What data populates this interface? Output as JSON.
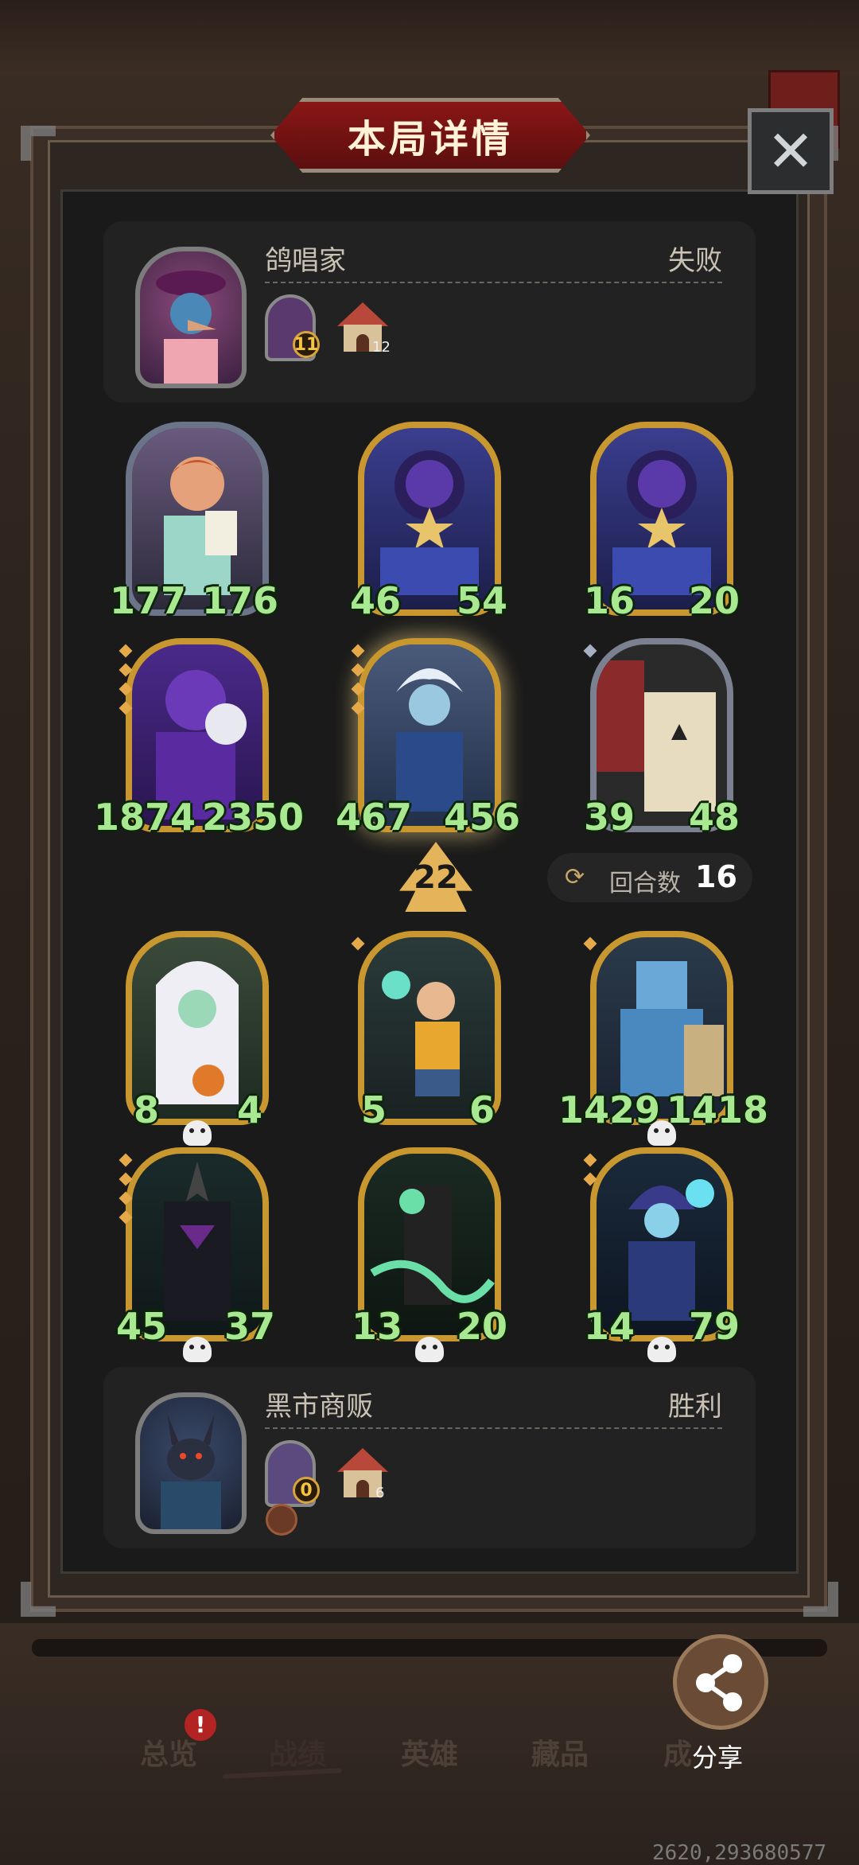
{
  "title": "本局详情",
  "close_label": "✕",
  "opponent": {
    "name": "鸽唱家",
    "result": "失败",
    "tavern_level": "11",
    "house_count": "12"
  },
  "player": {
    "name": "黑市商贩",
    "result": "胜利",
    "tavern_level": "0",
    "house_count": "6"
  },
  "opponent_cards": [
    {
      "attack": "177",
      "health": "176"
    },
    {
      "attack": "46",
      "health": "54"
    },
    {
      "attack": "16",
      "health": "20"
    },
    {
      "attack": "1874",
      "health": "2350"
    },
    {
      "attack": "467",
      "health": "456"
    },
    {
      "attack": "39",
      "health": "48"
    }
  ],
  "player_cards": [
    {
      "attack": "8",
      "health": "4"
    },
    {
      "attack": "5",
      "health": "6"
    },
    {
      "attack": "1429",
      "health": "1418"
    },
    {
      "attack": "45",
      "health": "37"
    },
    {
      "attack": "13",
      "health": "20"
    },
    {
      "attack": "14",
      "health": "79"
    }
  ],
  "level_badge": "22",
  "round": {
    "label": "回合数",
    "value": "16"
  },
  "nav": [
    "总览",
    "战绩",
    "英雄",
    "藏品",
    "成"
  ],
  "alert": "!",
  "share_label": "分享",
  "coords_text": "2620,293680577"
}
